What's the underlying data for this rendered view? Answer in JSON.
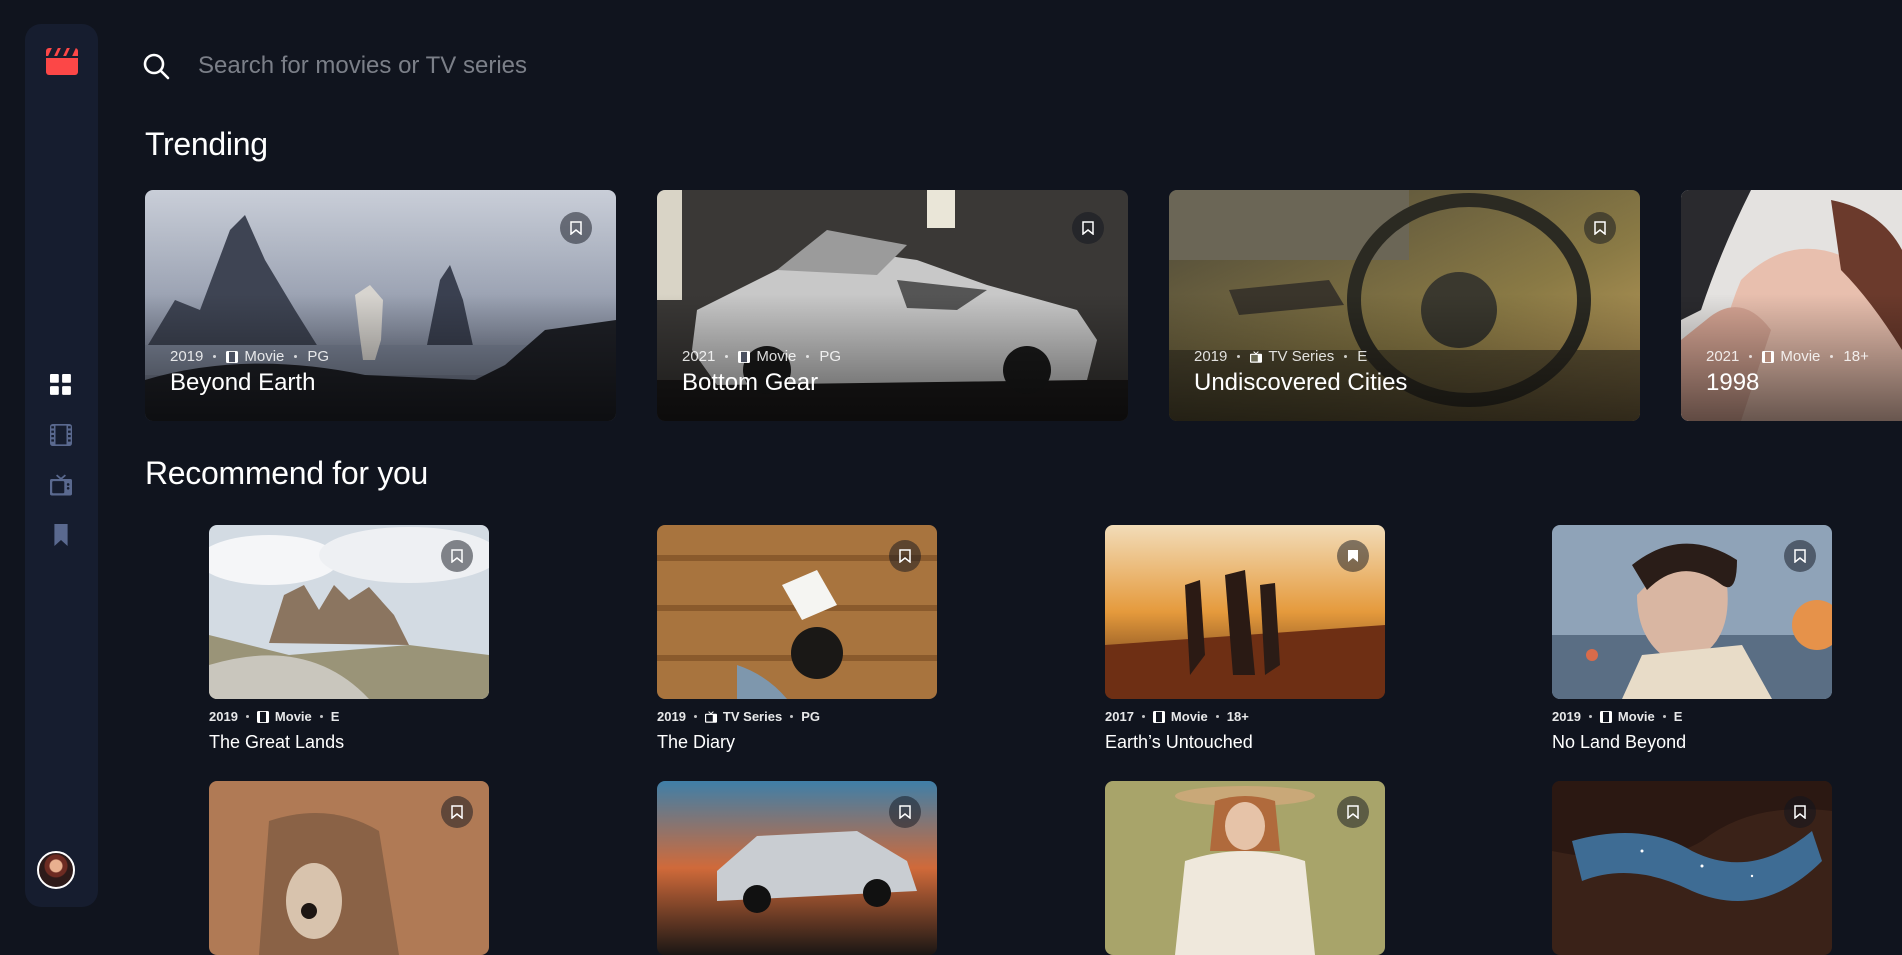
{
  "search": {
    "placeholder": "Search for movies or TV series"
  },
  "nav": {
    "items": [
      "home-icon",
      "movies-icon",
      "tv-series-icon",
      "bookmark-icon"
    ],
    "active": "home-icon"
  },
  "colors": {
    "accent": "#fc4747",
    "background": "#10141e",
    "sidebar": "#161d2f",
    "muted": "#5a698f"
  },
  "trending": {
    "title": "Trending",
    "items": [
      {
        "year": "2019",
        "category": "Movie",
        "rating": "PG",
        "title": "Beyond Earth"
      },
      {
        "year": "2021",
        "category": "Movie",
        "rating": "PG",
        "title": "Bottom Gear"
      },
      {
        "year": "2019",
        "category": "TV Series",
        "rating": "E",
        "title": "Undiscovered Cities"
      },
      {
        "year": "2021",
        "category": "Movie",
        "rating": "18+",
        "title": "1998"
      }
    ]
  },
  "recommended": {
    "title": "Recommend for you",
    "items": [
      {
        "year": "2019",
        "category": "Movie",
        "rating": "E",
        "title": "The Great Lands"
      },
      {
        "year": "2019",
        "category": "TV Series",
        "rating": "PG",
        "title": "The Diary"
      },
      {
        "year": "2017",
        "category": "Movie",
        "rating": "18+",
        "title": "Earth’s Untouched"
      },
      {
        "year": "2019",
        "category": "Movie",
        "rating": "E",
        "title": "No Land Beyond"
      }
    ]
  }
}
